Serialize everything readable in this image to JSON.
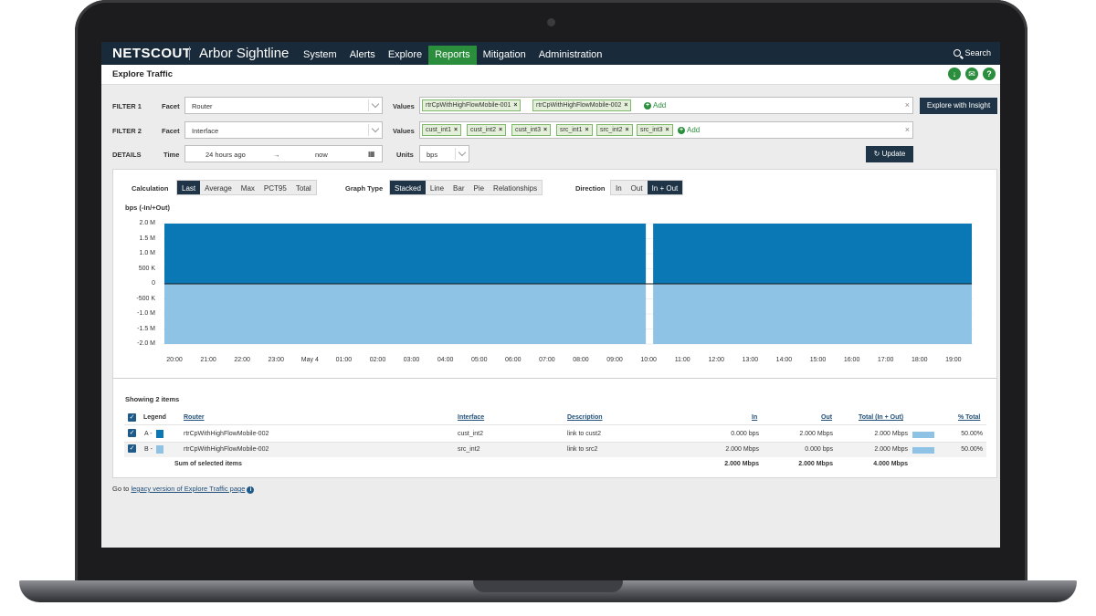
{
  "brand": "NETSCOUT",
  "product": "Arbor Sightline",
  "nav": [
    "System",
    "Alerts",
    "Explore",
    "Reports",
    "Mitigation",
    "Administration"
  ],
  "nav_active": "Reports",
  "search_label": "Search",
  "page_title": "Explore Traffic",
  "page_icons": [
    "download-icon",
    "email-icon",
    "help-icon"
  ],
  "filter1": {
    "label": "FILTER 1",
    "facet_label": "Facet",
    "facet": "Router",
    "values_label": "Values",
    "values": [
      "rtrCpWithHighFlowMobile-001",
      "rtrCpWithHighFlowMobile-002"
    ],
    "add_label": "Add"
  },
  "filter2": {
    "label": "FILTER 2",
    "facet_label": "Facet",
    "facet": "Interface",
    "values_label": "Values",
    "values": [
      "cust_int1",
      "cust_int2",
      "cust_int3",
      "src_int1",
      "src_int2",
      "src_int3"
    ],
    "add_label": "Add"
  },
  "details": {
    "label": "DETAILS",
    "time_label": "Time",
    "time_from": "24 hours ago",
    "time_to": "now",
    "units_label": "Units",
    "units": "bps"
  },
  "explore_insight_button": "Explore with Insight",
  "update_button": "Update",
  "calculation": {
    "label": "Calculation",
    "options": [
      "Last",
      "Average",
      "Max",
      "PCT95",
      "Total"
    ],
    "selected": "Last"
  },
  "graph_type": {
    "label": "Graph Type",
    "options": [
      "Stacked",
      "Line",
      "Bar",
      "Pie",
      "Relationships"
    ],
    "selected": "Stacked"
  },
  "direction": {
    "label": "Direction",
    "options": [
      "In",
      "Out",
      "In + Out"
    ],
    "selected": "In + Out"
  },
  "chart_data": {
    "type": "area",
    "title": "",
    "ylabel": "bps (-In/+Out)",
    "y_ticks": [
      "2.0 M",
      "1.5 M",
      "1.0 M",
      "500 K",
      "0",
      "-500 K",
      "-1.0 M",
      "-1.5 M",
      "-2.0 M"
    ],
    "ylim": [
      -2000000,
      2000000
    ],
    "x_ticks": [
      "20:00",
      "21:00",
      "22:00",
      "23:00",
      "May 4",
      "01:00",
      "02:00",
      "03:00",
      "04:00",
      "05:00",
      "06:00",
      "07:00",
      "08:00",
      "09:00",
      "10:00",
      "11:00",
      "12:00",
      "13:00",
      "14:00",
      "15:00",
      "16:00",
      "17:00",
      "18:00",
      "19:00"
    ],
    "gap": [
      "09:55",
      "10:05"
    ],
    "series": [
      {
        "name": "A",
        "color": "#0a78b4",
        "value": 2000000
      },
      {
        "name": "B",
        "color": "#8ec3e6",
        "value": -2000000
      }
    ]
  },
  "table": {
    "showing": "Showing 2 items",
    "headers": [
      "Legend",
      "Router",
      "Interface",
      "Description",
      "In",
      "Out",
      "Total (In + Out)",
      "% Total"
    ],
    "rows": [
      {
        "legend": "A -",
        "color": "#0a78b4",
        "router": "rtrCpWithHighFlowMobile-002",
        "interface": "cust_int2",
        "description": "link to cust2",
        "in": "0.000 bps",
        "out": "2.000 Mbps",
        "total": "2.000 Mbps",
        "pct": "50.00%",
        "pct_value": 50
      },
      {
        "legend": "B -",
        "color": "#8ec3e6",
        "router": "rtrCpWithHighFlowMobile-002",
        "interface": "src_int2",
        "description": "link to src2",
        "in": "2.000 Mbps",
        "out": "0.000 bps",
        "total": "2.000 Mbps",
        "pct": "50.00%",
        "pct_value": 50
      }
    ],
    "sum_label": "Sum of selected items",
    "sum_in": "2.000 Mbps",
    "sum_out": "2.000 Mbps",
    "sum_total": "4.000 Mbps"
  },
  "footer": {
    "prefix": "Go to",
    "link": "legacy version of Explore Traffic page"
  }
}
